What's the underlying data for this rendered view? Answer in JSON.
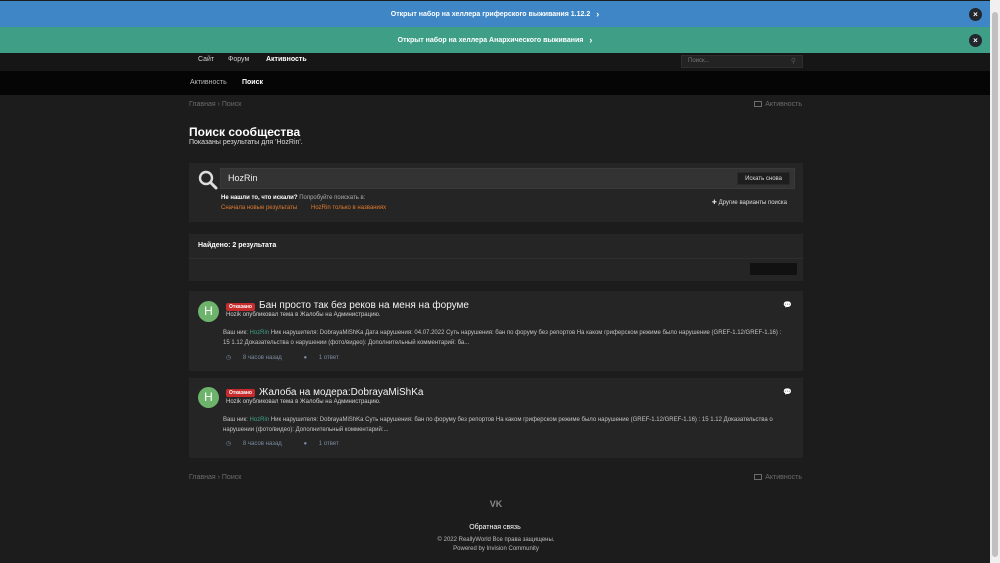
{
  "banners": [
    {
      "text": "Открыт набор на хеллера гриферского выживания 1.12.2",
      "close": "×"
    },
    {
      "text": "Открыт набор на хеллера Анархического выживания",
      "close": "×"
    }
  ],
  "nav": {
    "tabs": [
      "Сайт",
      "Форум",
      "Активность"
    ],
    "active_tab": "Активность",
    "search_placeholder": "Поиск..."
  },
  "subnav": {
    "items": [
      "Активность",
      "Поиск"
    ],
    "active": "Поиск"
  },
  "breadcrumb": {
    "home": "Главная",
    "current": "Поиск",
    "activity": "Активность"
  },
  "page": {
    "title": "Поиск сообщества",
    "subtitle": "Показаны результаты для 'HozRin'."
  },
  "search": {
    "query": "HozRin",
    "button": "Искать снова",
    "not_found_bold": "Не нашли то, что искали?",
    "not_found_rest": " Попробуйте поискать в:",
    "suggest_new": "Сначала новые результаты",
    "suggest_title": "HozRin только в названиях",
    "other_options": "Другие варианты поиска"
  },
  "results_header": "Найдено: 2 результата",
  "results": [
    {
      "avatar": "H",
      "badge": "Отказано",
      "title": "Бан просто так без реков на меня на форуме",
      "meta": "Hozik опубликовал тема в Жалобы на Администрацию.",
      "body_label": "Ваш ник:",
      "body_nick": "HozRin",
      "body_text": "Ник нарушителя: DobrayaMiShKa Дата нарушения: 04.07.2022 Суть нарушения: бан по форуму без репортов На каком гриферском режиме было нарушение (GREF-1.12/GREF-1.16) : 15 1.12 Доказательства о нарушении (фото/видео): Дополнительный комментарий: ба...",
      "time": "8 часов назад",
      "replies": "1 ответ"
    },
    {
      "avatar": "H",
      "badge": "Отказано",
      "title": "Жалоба на модера:DobrayaMiShKa",
      "meta": "Hozik опубликовал тема в Жалобы на Администрацию.",
      "body_label": "Ваш ник:",
      "body_nick": "HozRin",
      "body_text": "Ник нарушителя: DobrayaMiShKa Суть нарушения: бан по форуму без репортов На каком гриферском режиме было нарушение (GREF-1.12/GREF-1.16) : 15 1.12 Доказательства о нарушении (фото/видео): Дополнительный комментарий:...",
      "time": "8 часов назад",
      "replies": "1 ответ"
    }
  ],
  "footer": {
    "vk": "VK",
    "feedback": "Обратная связь",
    "copyright": "© 2022 ReallyWorld Все права защищены.",
    "powered": "Powered by Invision Community"
  },
  "colors": {
    "banner_blue": "#3e86c6",
    "banner_green": "#3e9f86",
    "badge_red": "#c62c2c",
    "link_orange": "#e07a2e",
    "avatar_green": "#6db36b"
  }
}
